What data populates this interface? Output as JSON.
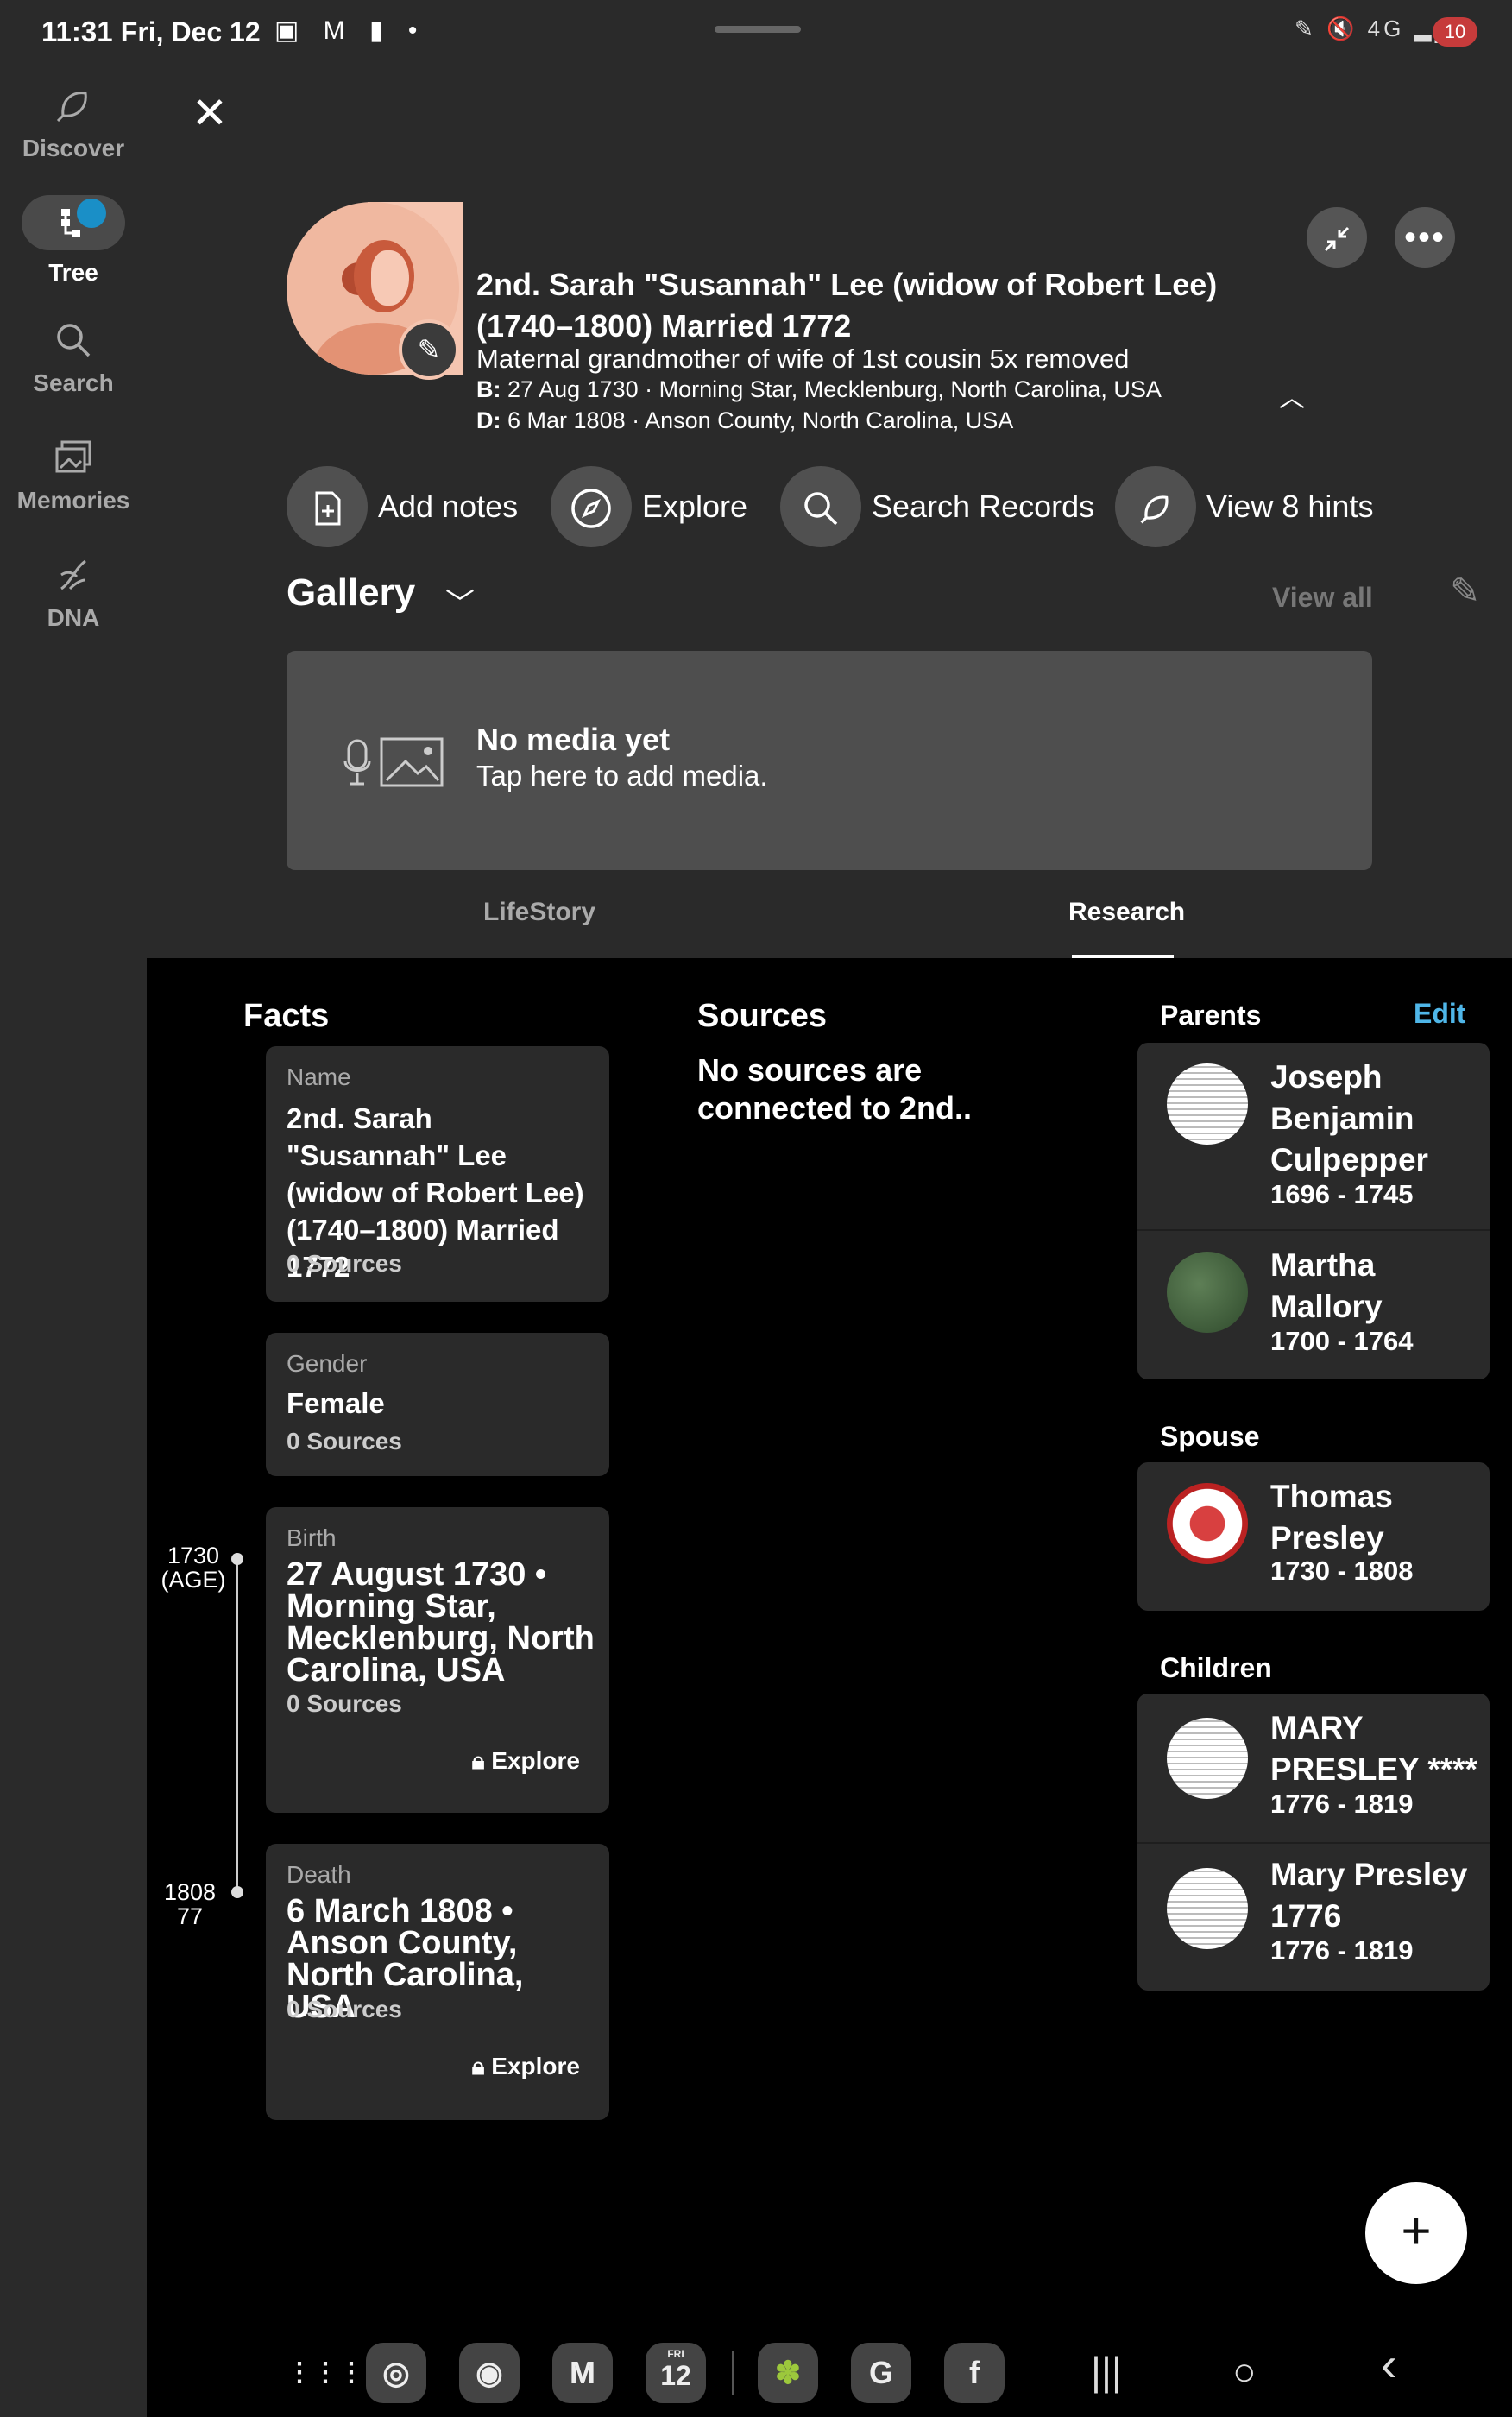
{
  "status_bar": {
    "time": "11:31",
    "date": "Fri, Dec 12",
    "left_icons": "▣ M ▮ •",
    "right_icons": "✎ 🔇 4G ▂▄▆",
    "battery": "10"
  },
  "rail": {
    "items": [
      {
        "label": "Discover",
        "icon": "discover-leaf-icon"
      },
      {
        "label": "Tree",
        "icon": "tree-icon"
      },
      {
        "label": "Search",
        "icon": "search-icon"
      },
      {
        "label": "Memories",
        "icon": "memories-icon"
      },
      {
        "label": "DNA",
        "icon": "dna-icon"
      }
    ]
  },
  "header": {
    "close": "✕",
    "name": "2nd. Sarah \"Susannah\" Lee (widow of Robert Lee) (1740–1800) Married 1772",
    "relation": "Maternal grandmother of wife of 1st cousin 5x removed",
    "birth_label": "B:",
    "birth_value": "27 Aug 1730 · Morning Star, Mecklenburg, North Carolina, USA",
    "death_label": "D:",
    "death_value": "6 Mar 1808 · Anson County, North Carolina, USA"
  },
  "actions": [
    {
      "label": "Add notes",
      "icon": "add-note-icon"
    },
    {
      "label": "Explore",
      "icon": "compass-icon"
    },
    {
      "label": "Search Records",
      "icon": "search-icon"
    },
    {
      "label": "View 8 hints",
      "icon": "hint-leaf-icon"
    }
  ],
  "gallery": {
    "title": "Gallery",
    "view_all": "View all",
    "empty_title": "No media yet",
    "empty_sub": "Tap here to add media."
  },
  "tabs": [
    {
      "label": "LifeStory",
      "active": false
    },
    {
      "label": "Research",
      "active": true
    }
  ],
  "facts": {
    "title": "Facts",
    "items": [
      {
        "label": "Name",
        "value": "2nd. Sarah \"Susannah\" Lee (widow of Robert Lee) (1740–1800) Married 1772",
        "sources": "0 Sources"
      },
      {
        "label": "Gender",
        "value": "Female",
        "sources": "0 Sources"
      },
      {
        "label": "Birth",
        "value": "27 August 1730 • Morning Star, Mecklenburg, North Carolina, USA",
        "sources": "0 Sources",
        "explore": "Explore"
      },
      {
        "label": "Death",
        "value": "6 March 1808 • Anson County, North Carolina, USA",
        "sources": "0 Sources",
        "explore": "Explore"
      }
    ],
    "timeline": [
      {
        "year": "1730",
        "age": "(AGE)"
      },
      {
        "year": "1808",
        "age": "77"
      }
    ]
  },
  "sources": {
    "title": "Sources",
    "empty": "No sources are connected to 2nd.."
  },
  "family": {
    "parents_title": "Parents",
    "edit": "Edit",
    "parents": [
      {
        "name": "Joseph Benjamin Culpepper",
        "dates": "1696 - 1745"
      },
      {
        "name": "Martha Mallory",
        "dates": "1700 - 1764"
      }
    ],
    "spouse_title": "Spouse",
    "spouse": {
      "name": "Thomas Presley",
      "dates": "1730 - 1808"
    },
    "children_title": "Children",
    "children": [
      {
        "name": "MARY PRESLEY ****",
        "dates": "1776 - 1819"
      },
      {
        "name": "Mary Presley 1776",
        "dates": "1776 - 1819"
      }
    ]
  },
  "fab": "+",
  "navbar": {
    "apps": [
      "⋮⋮⋮",
      "◎",
      "◉",
      "M",
      "12",
      "✽",
      "G",
      "f"
    ],
    "calendar_day": "FRI",
    "recents": "|||",
    "home": "○",
    "back": "‹"
  },
  "colors": {
    "accent": "#4fb6e8",
    "tree_badge": "#1a8fc7",
    "background": "#2a2a2a",
    "panel": "#000000",
    "card": "#2a2a2a"
  }
}
